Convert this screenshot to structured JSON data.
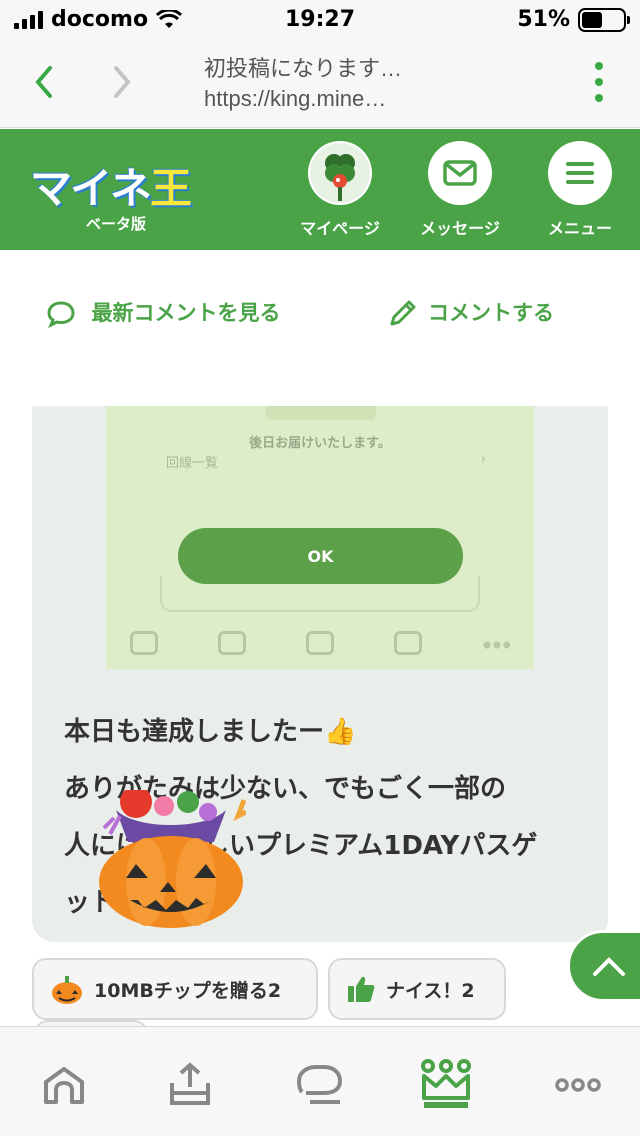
{
  "status_bar": {
    "carrier": "docomo",
    "time": "19:27",
    "battery_percent": "51%",
    "battery_level": 0.51
  },
  "browser": {
    "page_title": "初投稿になります…",
    "url": "https://king.mine…"
  },
  "site": {
    "logo_text_left": "マイネ",
    "logo_text_right": "王",
    "logo_sub": "ベータ版",
    "nav": {
      "mypage": "マイページ",
      "messages": "メッセージ",
      "menu": "メニュー"
    }
  },
  "actions": {
    "latest_comments": "最新コメントを見る",
    "comment": "コメントする"
  },
  "post": {
    "image": {
      "small_text": "後日お届けいたします。",
      "row_label": "回線一覧",
      "ok_label": "OK"
    },
    "text_lines": [
      "本日も達成しましたー👍",
      "ありがたみは少ない、でもごく一部の",
      "人には  うれしいプレミアム1DAYパスゲ",
      "ット！"
    ]
  },
  "reactions": {
    "gift_chip": "10MBチップを贈る2",
    "nice_chip": "ナイス！2"
  },
  "icons": {
    "back": "chevron-left-icon",
    "forward": "chevron-right-icon",
    "more": "kebab-icon",
    "message": "envelope-icon",
    "menu": "hamburger-icon",
    "latest": "speech-bubble-icon",
    "comment": "pencil-icon",
    "scroll_top": "chevron-up-icon",
    "tab_home": "home-icon",
    "tab_upload": "upload-icon",
    "tab_chat": "chat-icon",
    "tab_crown": "crown-icon",
    "tab_more": "dots-icon"
  },
  "colors": {
    "brand_green": "#4aa346",
    "logo_blue": "#2c7fcf",
    "logo_yellow": "#f7e83b",
    "card_bg": "#eaeeeb"
  }
}
